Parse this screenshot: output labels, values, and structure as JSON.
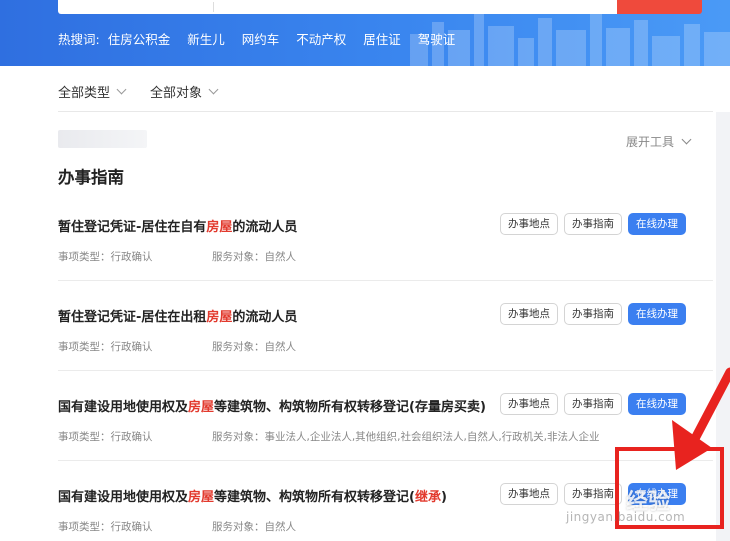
{
  "hot_search": {
    "label": "热搜词:",
    "items": [
      "住房公积金",
      "新生儿",
      "网约车",
      "不动产权",
      "居住证",
      "驾驶证"
    ]
  },
  "filters": [
    {
      "label": "全部类型"
    },
    {
      "label": "全部对象"
    }
  ],
  "expand_tools": "展开工具",
  "section_title": "办事指南",
  "items": [
    {
      "title_pre": "暂住登记凭证-居住在自有",
      "title_hl": "房屋",
      "title_post": "的流动人员",
      "title_hl2": "",
      "title_end": "",
      "type": "事项类型：行政确认",
      "target": "服务对象：自然人",
      "btn1": "办事地点",
      "btn2": "办事指南",
      "btn3": "在线办理"
    },
    {
      "title_pre": "暂住登记凭证-居住在出租",
      "title_hl": "房屋",
      "title_post": "的流动人员",
      "title_hl2": "",
      "title_end": "",
      "type": "事项类型：行政确认",
      "target": "服务对象：自然人",
      "btn1": "办事地点",
      "btn2": "办事指南",
      "btn3": "在线办理"
    },
    {
      "title_pre": "国有建设用地使用权及",
      "title_hl": "房屋",
      "title_post": "等建筑物、构筑物所有权转移登记(存量房买卖)",
      "title_hl2": "",
      "title_end": "",
      "type": "事项类型：行政确认",
      "target": "服务对象：事业法人,企业法人,其他组织,社会组织法人,自然人,行政机关,非法人企业",
      "btn1": "办事地点",
      "btn2": "办事指南",
      "btn3": "在线办理"
    },
    {
      "title_pre": "国有建设用地使用权及",
      "title_hl": "房屋",
      "title_post": "等建筑物、构筑物所有权转移登记(",
      "title_hl2": "继承",
      "title_end": ")",
      "type": "事项类型：行政确认",
      "target": "服务对象：自然人",
      "btn1": "办事地点",
      "btn2": "办事指南",
      "btn3": "在线办理"
    }
  ],
  "watermark": {
    "text": "经验",
    "url": "jingyan.baidu.com"
  },
  "colors": {
    "banner": "#3a86ef",
    "primary": "#3b7ff0",
    "highlight": "#e23a2e",
    "annotation": "#e8231f"
  }
}
